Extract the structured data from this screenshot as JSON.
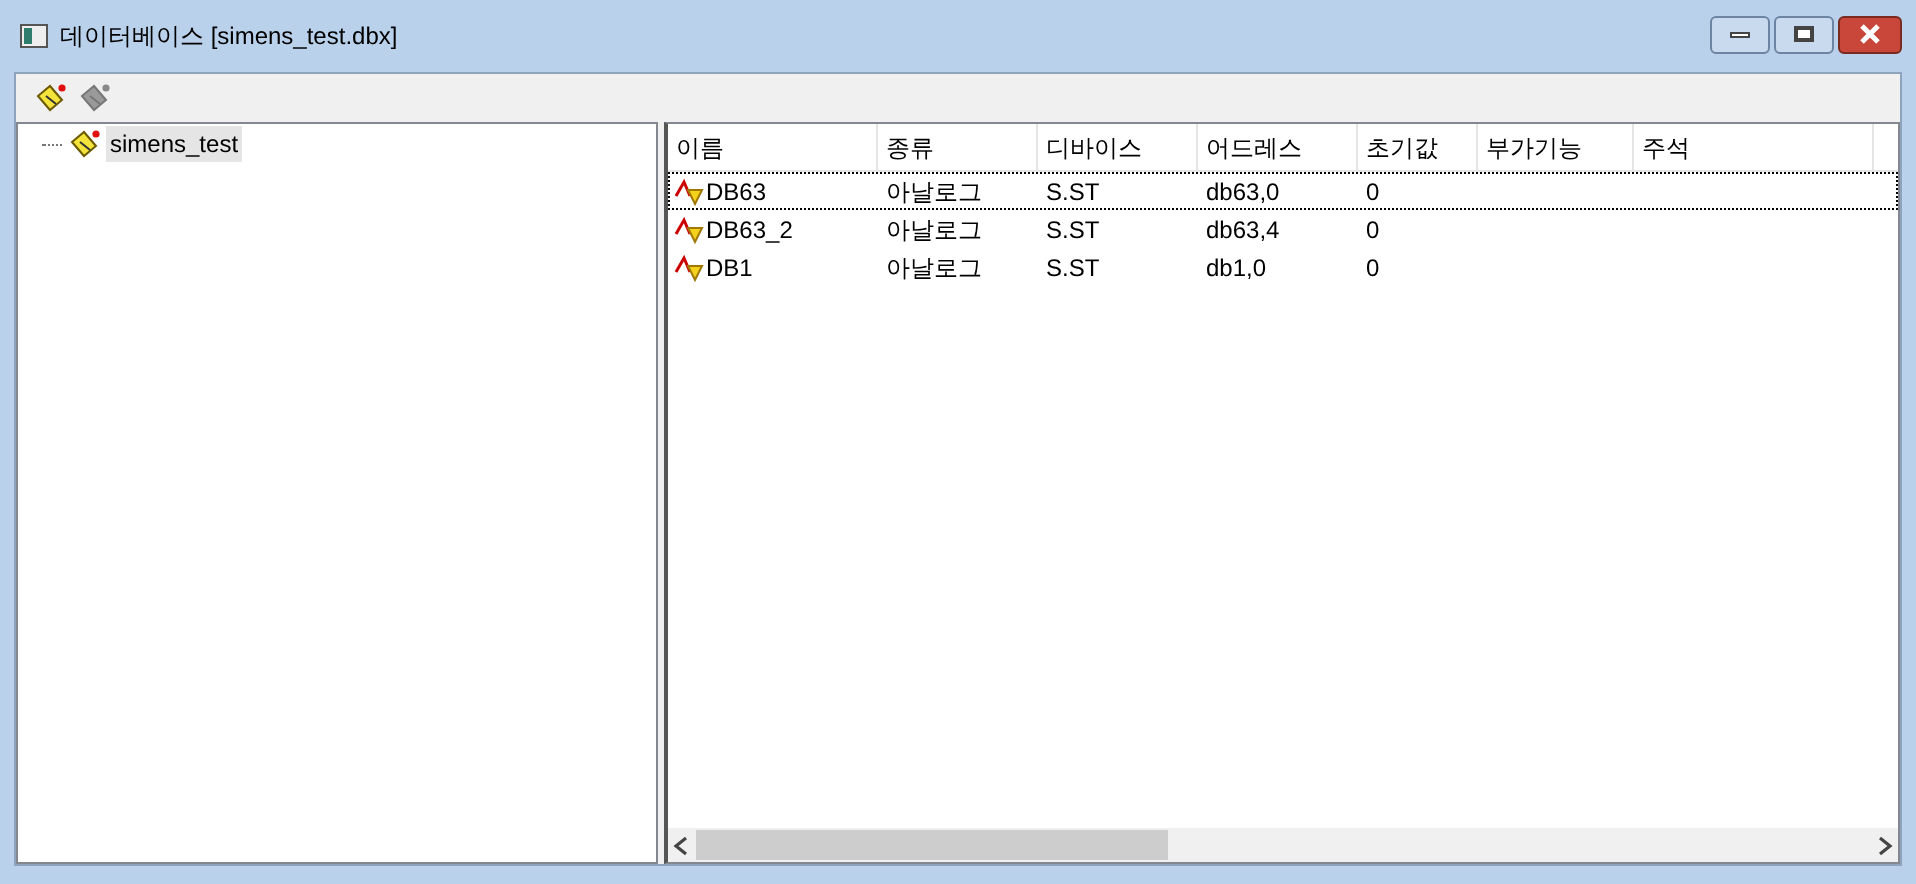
{
  "window": {
    "title": "데이터베이스 [simens_test.dbx]"
  },
  "tree": {
    "items": [
      {
        "label": "simens_test",
        "selected": true
      }
    ]
  },
  "table": {
    "columns": [
      "이름",
      "종류",
      "디바이스",
      "어드레스",
      "초기값",
      "부가기능",
      "주석"
    ],
    "rows": [
      {
        "selected": true,
        "cells": [
          "DB63",
          "아날로그",
          "S.ST",
          "db63,0",
          "0"
        ]
      },
      {
        "selected": false,
        "cells": [
          "DB63_2",
          "아날로그",
          "S.ST",
          "db63,4",
          "0"
        ]
      },
      {
        "selected": false,
        "cells": [
          "DB1",
          "아날로그",
          "S.ST",
          "db1,0",
          "0"
        ]
      }
    ]
  }
}
